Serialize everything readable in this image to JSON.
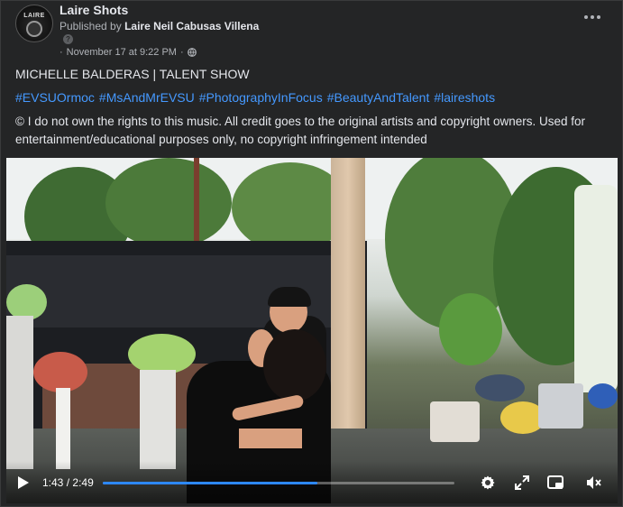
{
  "post": {
    "page_name": "Laire Shots",
    "published_prefix": "Published by",
    "publisher": "Laire Neil Cabusas Villena",
    "timestamp": "November 17 at 9:22 PM",
    "title": "MICHELLE BALDERAS | TALENT SHOW",
    "hashtags": [
      "#EVSUOrmoc",
      "#MsAndMrEVSU",
      "#PhotographyInFocus",
      "#BeautyAndTalent",
      "#laireshots"
    ],
    "disclaimer": "© I do not own the rights to this music. All credit goes to the original artists and copyright owners. Used for entertainment/educational purposes only, no copyright infringement intended",
    "avatar_text": "LAIRE"
  },
  "video": {
    "current_time": "1:43",
    "separator": "/",
    "duration": "2:49",
    "progress_fraction": 0.609,
    "time_display": "1:43 / 2:49"
  },
  "icons": {
    "more": "more-horizontal-icon",
    "help": "question-icon",
    "privacy": "globe-icon",
    "play": "play-icon",
    "settings": "gear-icon",
    "fullscreen": "expand-icon",
    "pip": "picture-in-picture-icon",
    "mute": "volume-muted-icon"
  },
  "colors": {
    "accent": "#2d88ff",
    "link": "#4599ff",
    "background": "#242526"
  }
}
